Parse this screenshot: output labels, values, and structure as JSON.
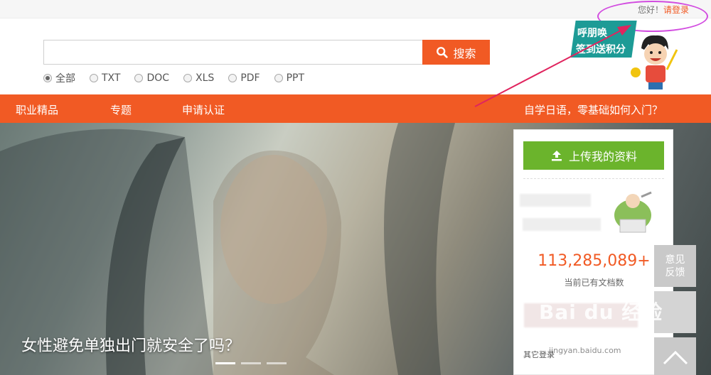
{
  "header": {
    "greeting": "您好！",
    "login_link": "请登录"
  },
  "search": {
    "placeholder": "",
    "button_label": "搜索",
    "filters": [
      {
        "label": "全部",
        "selected": true
      },
      {
        "label": "TXT",
        "selected": false
      },
      {
        "label": "DOC",
        "selected": false
      },
      {
        "label": "XLS",
        "selected": false
      },
      {
        "label": "PDF",
        "selected": false
      },
      {
        "label": "PPT",
        "selected": false
      }
    ]
  },
  "promo": {
    "line1": "呼朋唤",
    "line2": "签到送积分"
  },
  "nav": {
    "items": [
      "职业精品",
      "专题",
      "申请认证"
    ],
    "right_link": "自学日语，零基础如何入门？"
  },
  "hero": {
    "caption": "女性避免单独出门就安全了吗？"
  },
  "panel": {
    "upload_label": "上传我的资料",
    "doc_count": "113,285,089+",
    "doc_count_label": "当前已有文档数",
    "other_login": "其它登录"
  },
  "side": {
    "feedback_line1": "意见",
    "feedback_line2": "反馈"
  },
  "watermark": {
    "brand": "Bai du 经验",
    "url": "jingyan.baidu.com"
  },
  "colors": {
    "accent": "#f15a24",
    "upload_green": "#6bb42c",
    "annotation": "#d24ce0",
    "annotation_arrow": "#e0245e"
  }
}
